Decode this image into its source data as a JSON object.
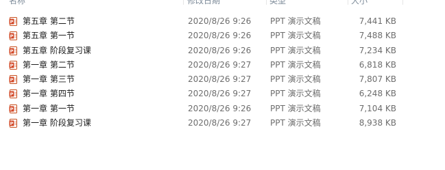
{
  "columns": {
    "name": "名称",
    "date": "修改日期",
    "type": "类型",
    "size": "大小"
  },
  "colors": {
    "ppt_icon": "#d24726",
    "header_text": "#7d8b99",
    "secondary_text": "#6d6d6d"
  },
  "file_icon": "ppt-file-icon",
  "files": [
    {
      "name": "第五章  第二节",
      "date": "2020/8/26 9:26",
      "type": "PPT 演示文稿",
      "size": "7,441 KB"
    },
    {
      "name": "第五章  第一节",
      "date": "2020/8/26 9:26",
      "type": "PPT 演示文稿",
      "size": "7,488 KB"
    },
    {
      "name": "第五章  阶段复习课",
      "date": "2020/8/26 9:26",
      "type": "PPT 演示文稿",
      "size": "7,234 KB"
    },
    {
      "name": "第一章  第二节",
      "date": "2020/8/26 9:27",
      "type": "PPT 演示文稿",
      "size": "6,818 KB"
    },
    {
      "name": "第一章  第三节",
      "date": "2020/8/26 9:27",
      "type": "PPT 演示文稿",
      "size": "7,807 KB"
    },
    {
      "name": "第一章  第四节",
      "date": "2020/8/26 9:27",
      "type": "PPT 演示文稿",
      "size": "6,248 KB"
    },
    {
      "name": "第一章  第一节",
      "date": "2020/8/26 9:26",
      "type": "PPT 演示文稿",
      "size": "7,104 KB"
    },
    {
      "name": "第一章  阶段复习课",
      "date": "2020/8/26 9:27",
      "type": "PPT 演示文稿",
      "size": "8,938 KB"
    }
  ]
}
